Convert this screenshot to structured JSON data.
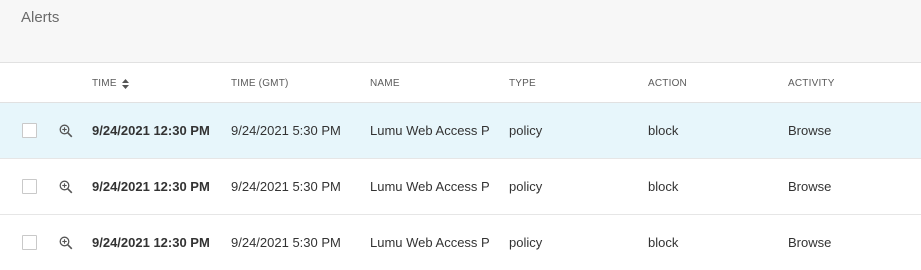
{
  "page": {
    "title": "Alerts"
  },
  "columns": {
    "time": "TIME",
    "time_gmt": "TIME (GMT)",
    "name": "NAME",
    "type": "TYPE",
    "action": "ACTION",
    "activity": "ACTIVITY"
  },
  "rows": [
    {
      "time": "9/24/2021 12:30 PM",
      "time_gmt": "9/24/2021 5:30 PM",
      "name": "Lumu Web Access P",
      "type": "policy",
      "action": "block",
      "activity": "Browse",
      "selected": true
    },
    {
      "time": "9/24/2021 12:30 PM",
      "time_gmt": "9/24/2021 5:30 PM",
      "name": "Lumu Web Access P",
      "type": "policy",
      "action": "block",
      "activity": "Browse",
      "selected": false
    },
    {
      "time": "9/24/2021 12:30 PM",
      "time_gmt": "9/24/2021 5:30 PM",
      "name": "Lumu Web Access P",
      "type": "policy",
      "action": "block",
      "activity": "Browse",
      "selected": false
    }
  ],
  "icons": {
    "sort": "sort-icon",
    "zoom": "zoom-in-icon"
  },
  "colors": {
    "selected_row": "#e7f6fb",
    "header_bg": "#f7f7f7",
    "icon": "#555555"
  }
}
